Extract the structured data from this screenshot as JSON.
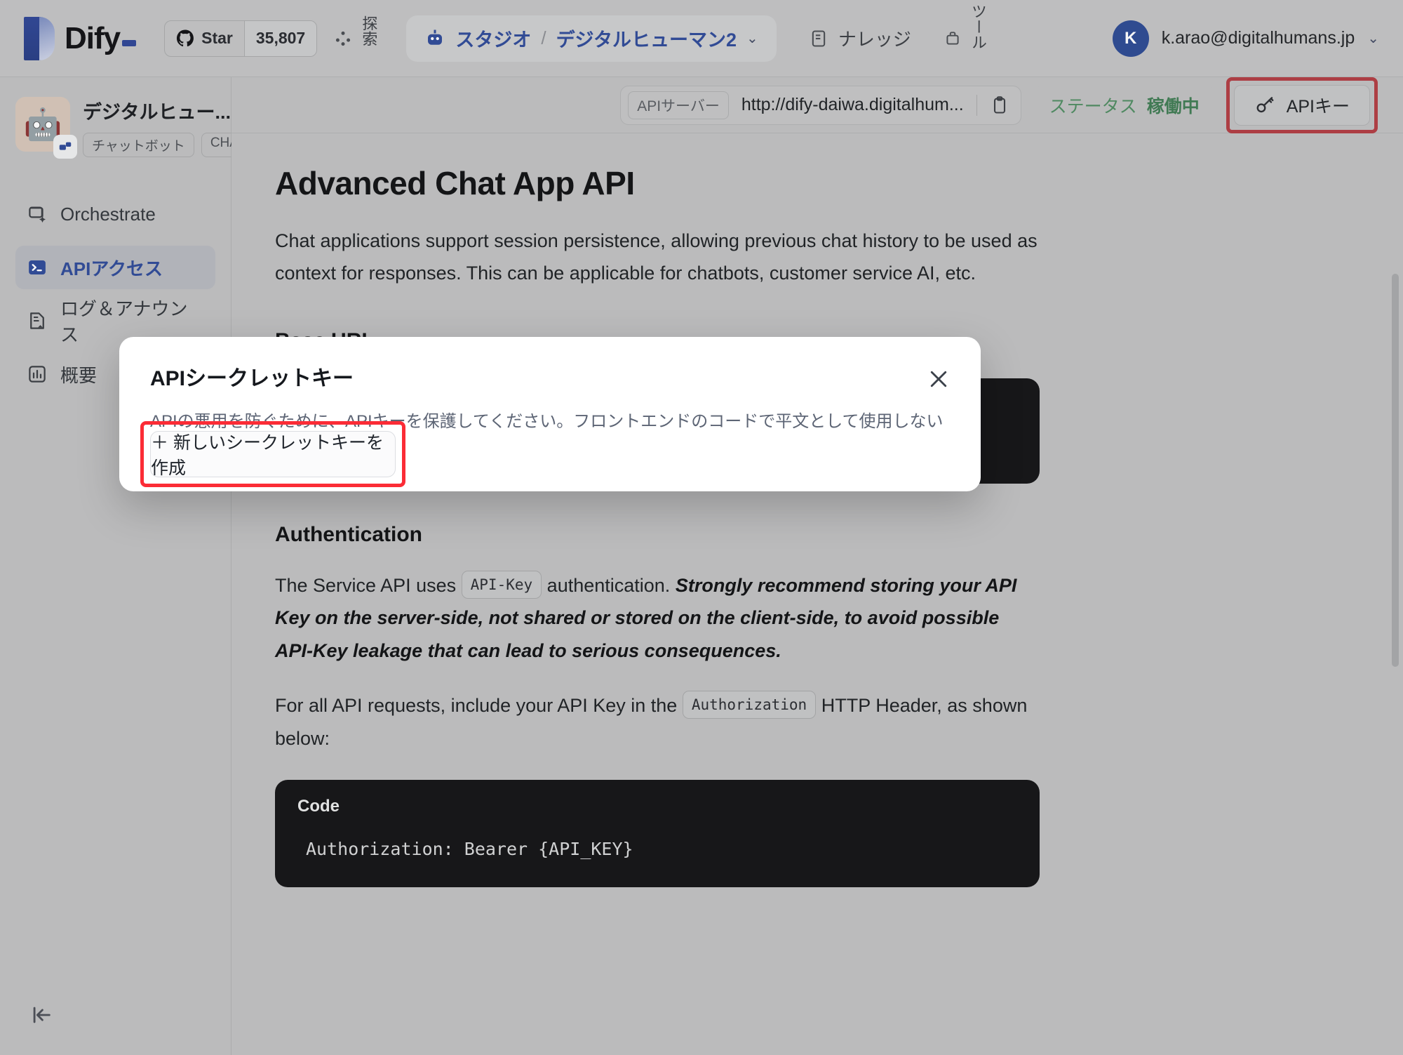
{
  "header": {
    "logo_text": "Dify",
    "star": {
      "label": "Star",
      "count": "35,807",
      "icon": "github-icon"
    },
    "explore": {
      "label": "探索",
      "icon": "explore-grid-icon"
    },
    "studio": {
      "workspace": "スタジオ",
      "separator": "/",
      "app": "デジタルヒューマン2",
      "chevron": "⌄",
      "icon": "robot-icon"
    },
    "knowledge": {
      "label": "ナレッジ",
      "icon": "book-icon"
    },
    "tools": {
      "label": "ツール",
      "icon": "toolbox-icon"
    },
    "account": {
      "initial": "K",
      "email": "k.arao@digitalhumans.jp",
      "chevron": "⌄"
    }
  },
  "sidebar": {
    "app": {
      "name": "デジタルヒュー...",
      "chevron": "⌄",
      "emoji": "🤖",
      "tags": [
        "チャットボット",
        "CHAT..."
      ]
    },
    "items": [
      {
        "label": "Orchestrate",
        "icon": "orchestrate-icon",
        "active": false
      },
      {
        "label": "APIアクセス",
        "icon": "terminal-icon",
        "active": true
      },
      {
        "label": "ログ＆アナウンス",
        "icon": "log-icon",
        "active": false
      },
      {
        "label": "概要",
        "icon": "chart-icon",
        "active": false
      }
    ],
    "collapse_icon": "collapse-left-icon"
  },
  "subbar": {
    "api_server_label": "APIサーバー",
    "api_server_url": "http://dify-daiwa.digitalhum...",
    "copy_icon": "clipboard-icon",
    "status_label": "ステータス",
    "status_value": "稼働中",
    "api_key_button": "APIキー",
    "api_key_icon": "key-icon",
    "highlight_color": "#fb2c36"
  },
  "main": {
    "title": "Advanced Chat App API",
    "intro": "Chat applications support session persistence, allowing previous chat history to be used as context for responses. This can be applicable for chatbots, customer service AI, etc.",
    "base_url_heading": "Base URL",
    "auth_heading": "Authentication",
    "auth_text_1": "The Service API uses",
    "auth_code_1": "API-Key",
    "auth_text_2": "authentication.",
    "auth_strong": "Strongly recommend storing your API Key on the server-side, not shared or stored on the client-side, to avoid possible API-Key leakage that can lead to serious consequences.",
    "header_text_1": "For all API requests, include your API Key in the",
    "header_code": "Authorization",
    "header_text_2": "HTTP Header, as shown below:",
    "code_block": {
      "title": "Code",
      "content": "Authorization: Bearer {API_KEY}"
    }
  },
  "modal": {
    "title": "APIシークレットキー",
    "description": "APIの悪用を防ぐために、APIキーを保護してください。フロントエンドのコードで平文として使用しないでください。:)",
    "close_icon": "close-icon",
    "create_button": "＋ 新しいシークレットキーを作成",
    "highlight_color": "#fb2c36"
  }
}
